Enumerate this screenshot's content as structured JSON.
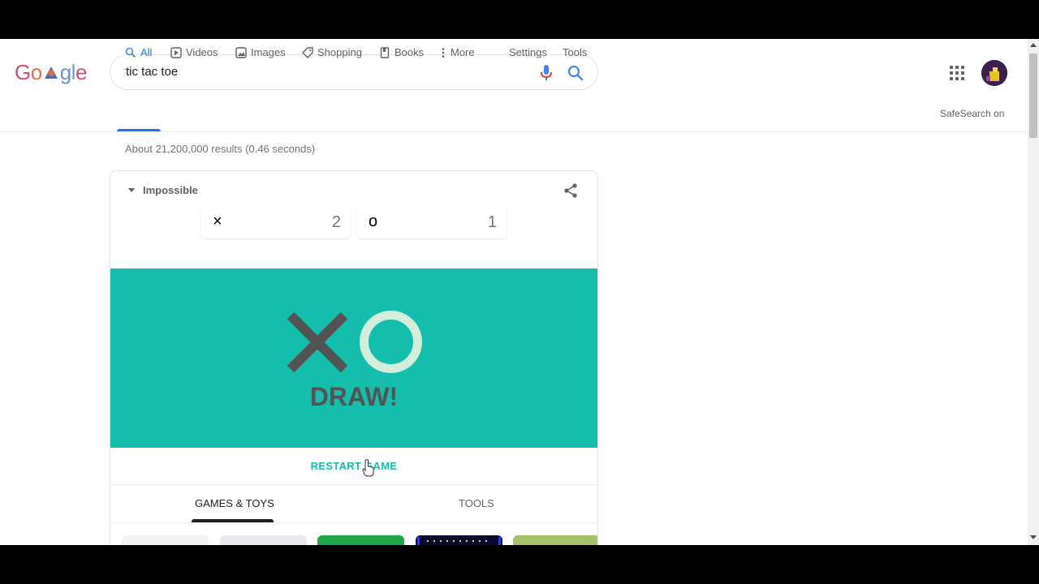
{
  "search": {
    "query": "tic tac toe"
  },
  "tabs": [
    {
      "label": "All",
      "icon": "search-icon",
      "active": true
    },
    {
      "label": "Videos",
      "icon": "play-icon"
    },
    {
      "label": "Images",
      "icon": "image-icon"
    },
    {
      "label": "Shopping",
      "icon": "tag-icon"
    },
    {
      "label": "Books",
      "icon": "book-icon"
    },
    {
      "label": "More",
      "icon": "more-vert-icon"
    },
    {
      "label": "Settings"
    },
    {
      "label": "Tools"
    }
  ],
  "safesearch": "SafeSearch on",
  "result_stats": "About 21,200,000 results (0.46 seconds)",
  "game": {
    "difficulty": "Impossible",
    "score_x_symbol": "×",
    "score_x": "2",
    "score_o_symbol": "o",
    "score_o": "1",
    "result": "DRAW!",
    "restart_label": "RESTART GAME",
    "board_color": "#14bdac"
  },
  "categories": {
    "games": "GAMES & TOYS",
    "tools": "TOOLS"
  },
  "colors": {
    "accent": "#1a73e8",
    "teal": "#14bdac"
  }
}
